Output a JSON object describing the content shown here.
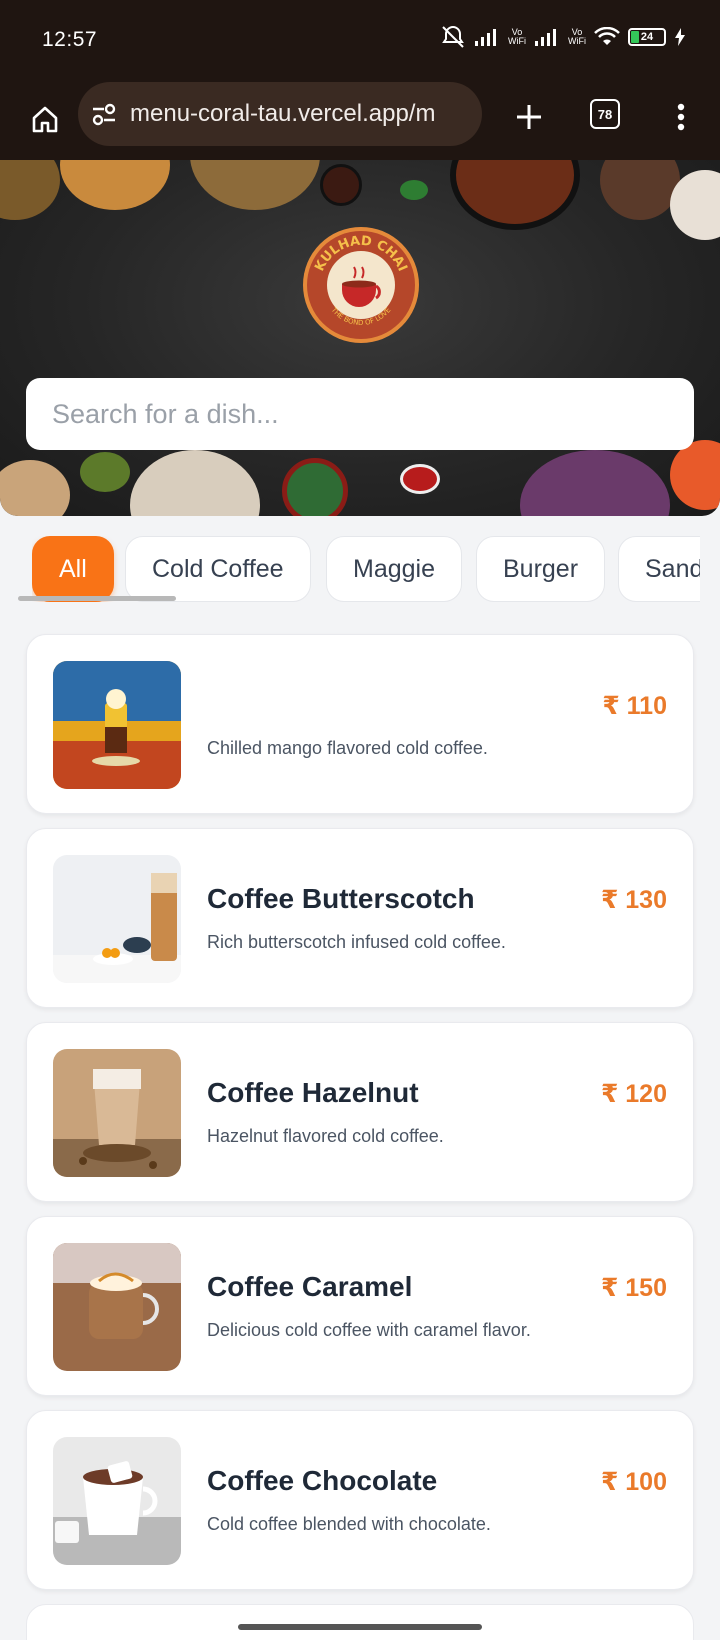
{
  "status_bar": {
    "time": "12:57",
    "battery": "24",
    "network_label_1": "Vo\nWiFi",
    "network_label_2": "Vo\nWiFi"
  },
  "browser": {
    "url": "menu-coral-tau.vercel.app/m",
    "tab_count": "78"
  },
  "search": {
    "placeholder": "Search for a dish..."
  },
  "categories": [
    {
      "label": "All",
      "active": true
    },
    {
      "label": "Cold Coffee",
      "active": false
    },
    {
      "label": "Maggie",
      "active": false
    },
    {
      "label": "Burger",
      "active": false
    },
    {
      "label": "Sand",
      "active": false
    }
  ],
  "menu": {
    "items": [
      {
        "name": "",
        "desc": "Chilled mango flavored cold coffee.",
        "price": "₹ 110"
      },
      {
        "name": "Coffee Butterscotch",
        "desc": "Rich butterscotch infused cold coffee.",
        "price": "₹ 130"
      },
      {
        "name": "Coffee Hazelnut",
        "desc": "Hazelnut flavored cold coffee.",
        "price": "₹ 120"
      },
      {
        "name": "Coffee Caramel",
        "desc": "Delicious cold coffee with caramel flavor.",
        "price": "₹ 150"
      },
      {
        "name": "Coffee Chocolate",
        "desc": "Cold coffee blended with chocolate.",
        "price": "₹ 100"
      }
    ]
  },
  "colors": {
    "accent": "#f97316",
    "price": "#ea7a2a",
    "chrome": "#1f1511"
  },
  "logo": {
    "brand": "KULHAD CHAI",
    "tagline": "THE BOND OF LOVE"
  }
}
